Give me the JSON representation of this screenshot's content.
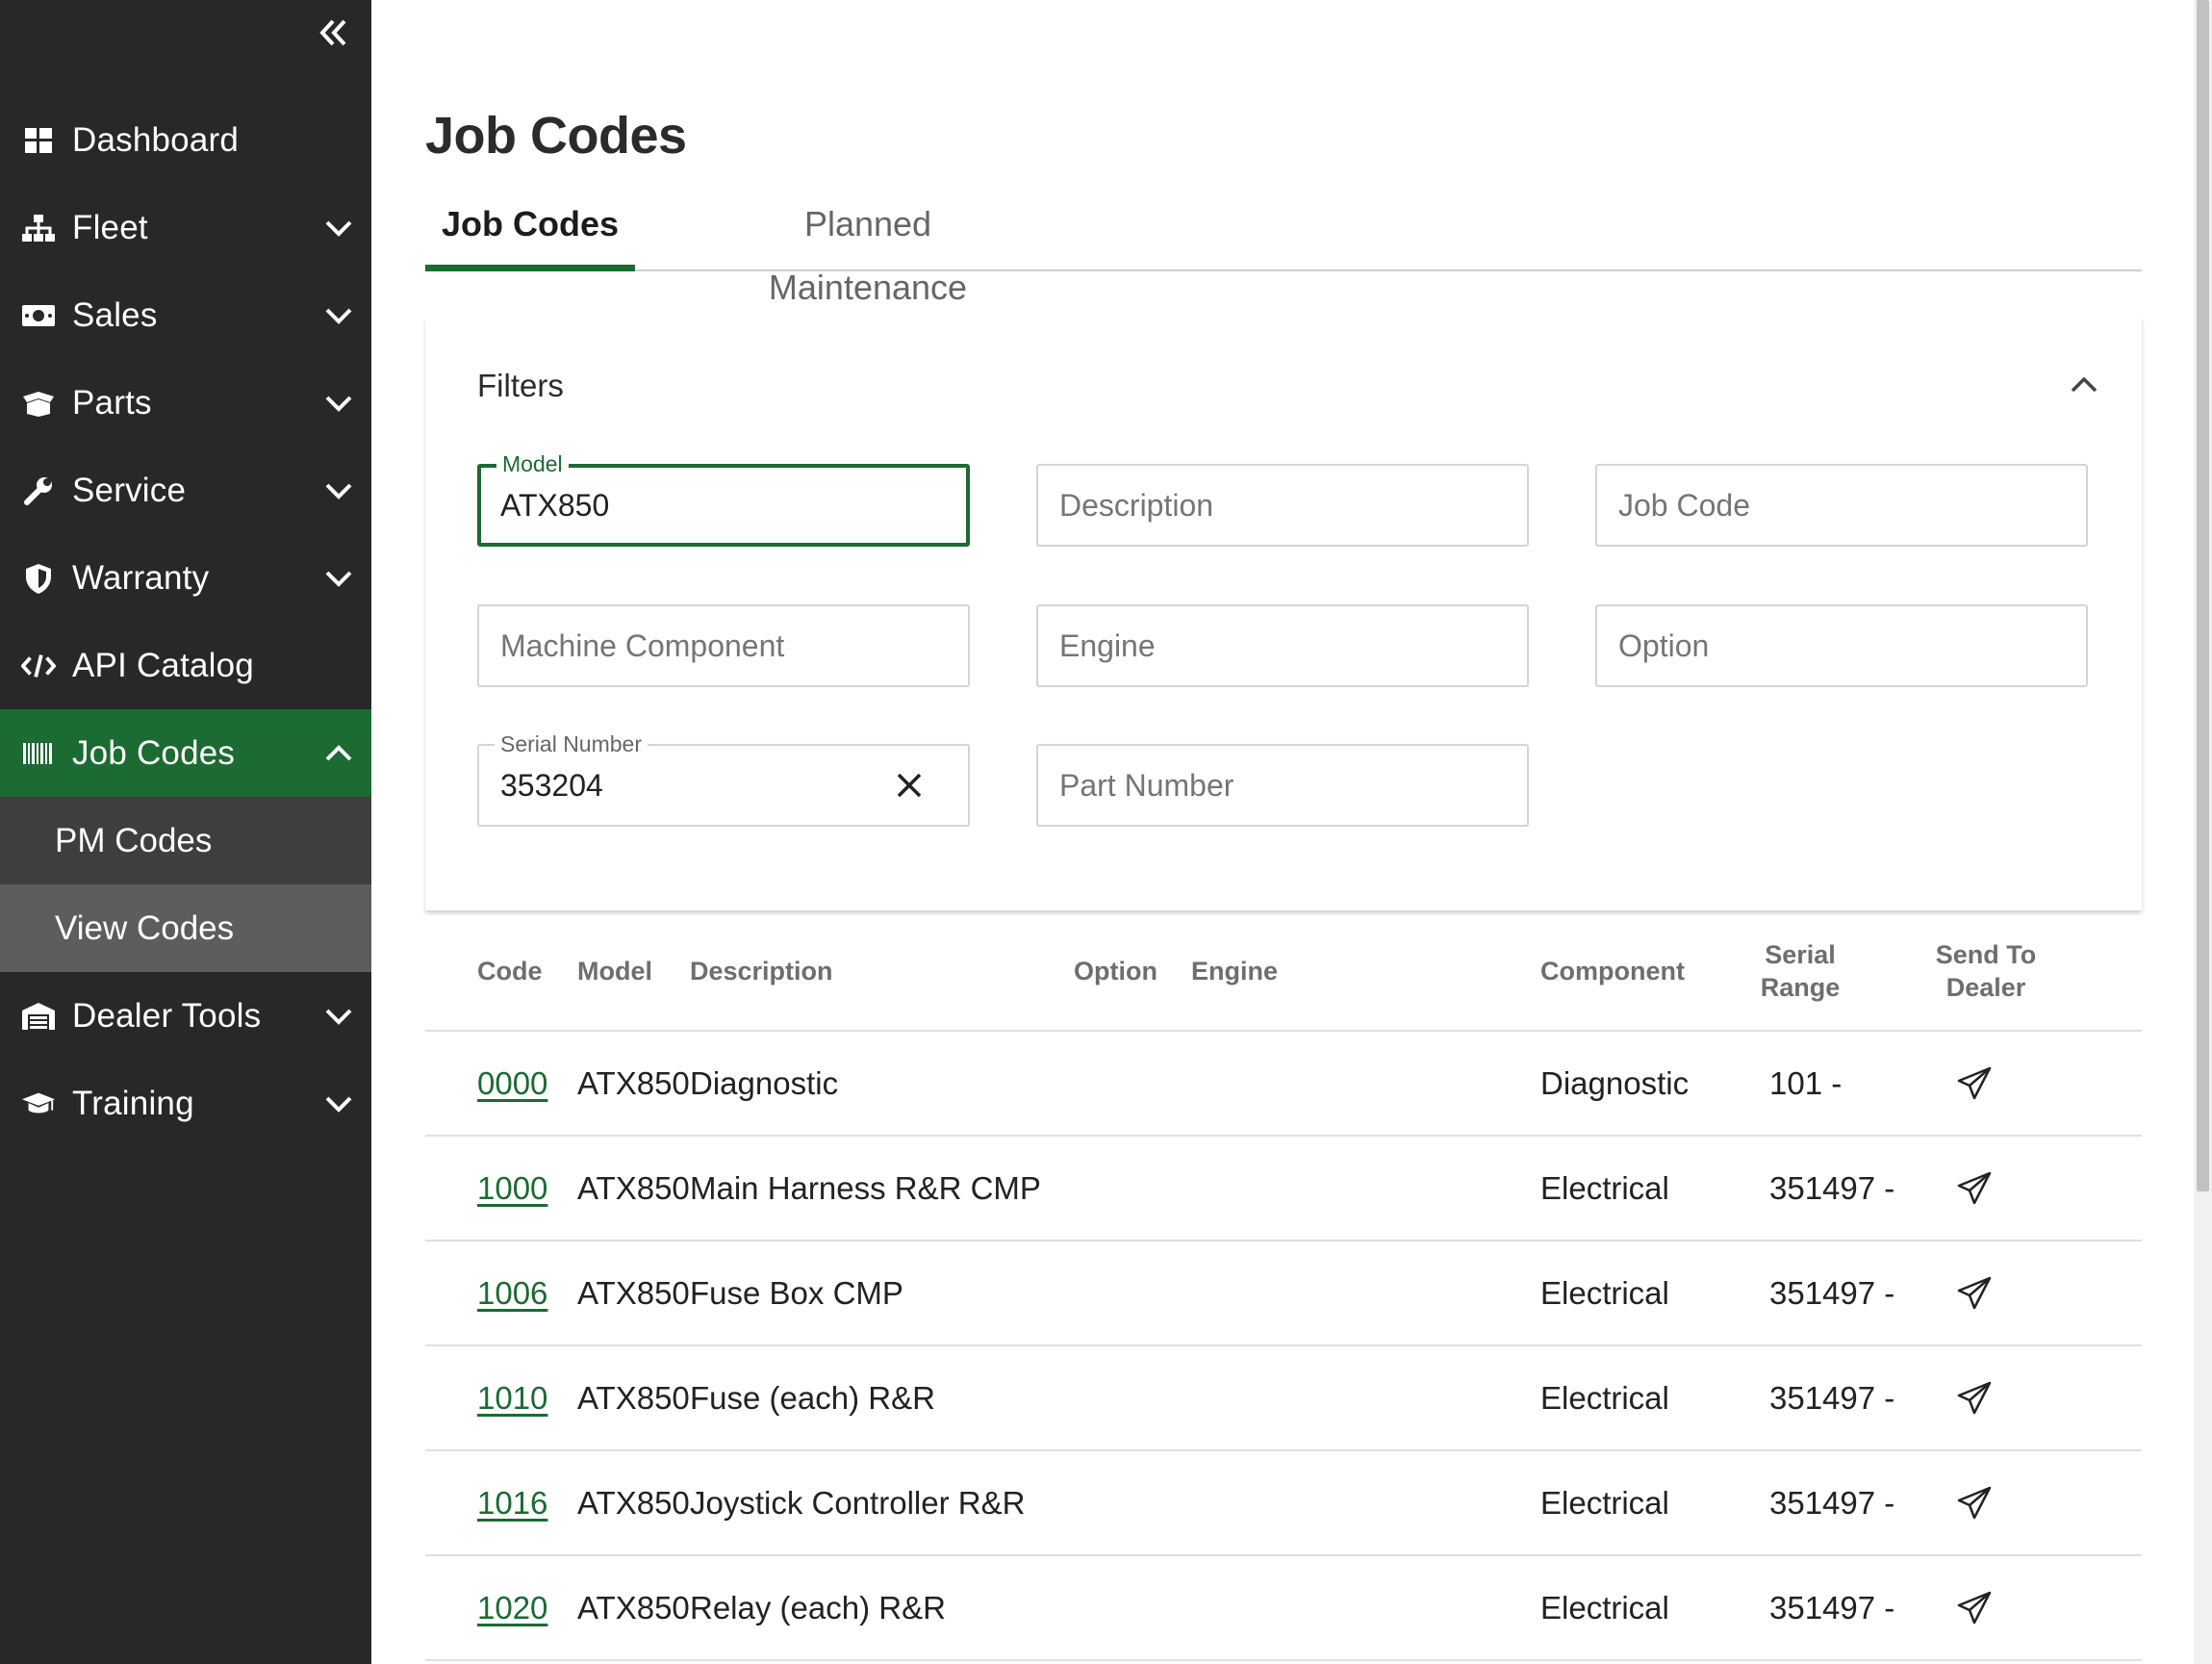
{
  "sidebar": {
    "collapse_icon": "double-chevron-left-icon",
    "items": [
      {
        "label": "Dashboard",
        "icon": "dashboard-grid-icon",
        "has_chevron": false
      },
      {
        "label": "Fleet",
        "icon": "sitemap-icon",
        "has_chevron": true
      },
      {
        "label": "Sales",
        "icon": "money-bill-icon",
        "has_chevron": true
      },
      {
        "label": "Parts",
        "icon": "box-open-icon",
        "has_chevron": true
      },
      {
        "label": "Service",
        "icon": "wrench-icon",
        "has_chevron": true
      },
      {
        "label": "Warranty",
        "icon": "shield-icon",
        "has_chevron": true
      },
      {
        "label": "API Catalog",
        "icon": "code-icon",
        "has_chevron": false
      },
      {
        "label": "Job Codes",
        "icon": "barcode-icon",
        "has_chevron": true,
        "expanded": true,
        "active": true
      },
      {
        "label": "Dealer Tools",
        "icon": "warehouse-icon",
        "has_chevron": true
      },
      {
        "label": "Training",
        "icon": "graduation-cap-icon",
        "has_chevron": true
      }
    ],
    "sub_items": [
      {
        "label": "PM Codes",
        "selected": false
      },
      {
        "label": "View Codes",
        "selected": true
      }
    ]
  },
  "page": {
    "title": "Job Codes",
    "tabs": [
      {
        "label": "Job Codes",
        "active": true
      },
      {
        "label": "Planned Maintenance",
        "active": false
      }
    ]
  },
  "filters": {
    "title": "Filters",
    "toggle_icon": "chevron-up-icon",
    "model": {
      "label": "Model",
      "value": "ATX850"
    },
    "description": {
      "placeholder": "Description"
    },
    "job_code": {
      "placeholder": "Job Code"
    },
    "machine_component": {
      "placeholder": "Machine Component"
    },
    "engine": {
      "placeholder": "Engine"
    },
    "option": {
      "placeholder": "Option"
    },
    "serial_number": {
      "label": "Serial Number",
      "value": "353204"
    },
    "part_number": {
      "placeholder": "Part Number"
    }
  },
  "table": {
    "headers": {
      "code": "Code",
      "model": "Model",
      "description": "Description",
      "option": "Option",
      "engine": "Engine",
      "component": "Component",
      "serial_range_1": "Serial",
      "serial_range_2": "Range",
      "send_1": "Send To",
      "send_2": "Dealer"
    },
    "rows": [
      {
        "code": "0000",
        "model": "ATX850",
        "description": "Diagnostic",
        "option": "",
        "engine": "",
        "component": "Diagnostic",
        "serial_range": "101 -"
      },
      {
        "code": "1000",
        "model": "ATX850",
        "description": "Main Harness R&R CMP",
        "option": "",
        "engine": "",
        "component": "Electrical",
        "serial_range": "351497 -"
      },
      {
        "code": "1006",
        "model": "ATX850",
        "description": "Fuse Box CMP",
        "option": "",
        "engine": "",
        "component": "Electrical",
        "serial_range": "351497 -"
      },
      {
        "code": "1010",
        "model": "ATX850",
        "description": "Fuse (each) R&R",
        "option": "",
        "engine": "",
        "component": "Electrical",
        "serial_range": "351497 -"
      },
      {
        "code": "1016",
        "model": "ATX850",
        "description": "Joystick Controller R&R",
        "option": "",
        "engine": "",
        "component": "Electrical",
        "serial_range": "351497 -"
      },
      {
        "code": "1020",
        "model": "ATX850",
        "description": "Relay (each) R&R",
        "option": "",
        "engine": "",
        "component": "Electrical",
        "serial_range": "351497 -"
      }
    ],
    "send_icon": "paper-plane-icon"
  },
  "colors": {
    "brand_green": "#1b6b32",
    "sidebar_bg": "#272827",
    "submenu_bg": "#3d3e3d",
    "submenu_selected": "#5c5d5c"
  }
}
